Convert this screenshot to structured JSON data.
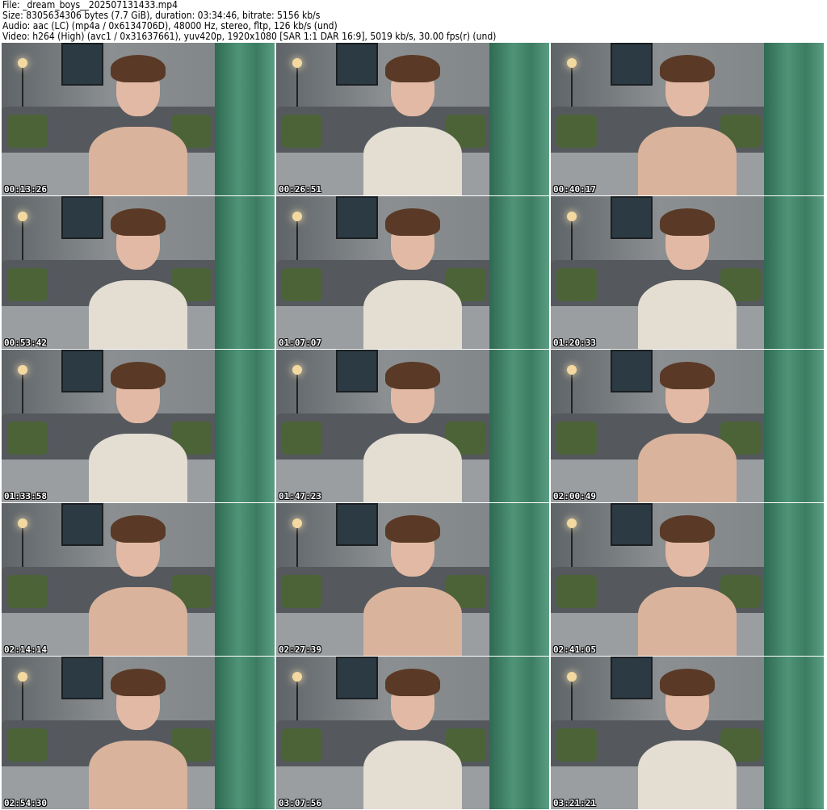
{
  "header": {
    "file": "File: _dream_boys__202507131433.mp4",
    "size": "Size: 8305634306 bytes (7.7 GiB), duration: 03:34:46, bitrate: 5156 kb/s",
    "audio": "Audio: aac (LC) (mp4a / 0x6134706D), 48000 Hz, stereo, fltp, 126 kb/s (und)",
    "video": "Video: h264 (High) (avc1 / 0x31637661), yuv420p, 1920x1080 [SAR 1:1 DAR 16:9], 5019 kb/s, 30.00 fps(r) (und)"
  },
  "thumbnails": [
    {
      "time": "00:13:26",
      "top": "#d9b39c"
    },
    {
      "time": "00:26:51",
      "top": "#e3ddd2"
    },
    {
      "time": "00:40:17",
      "top": "#d9b39c"
    },
    {
      "time": "00:53:42",
      "top": "#e3ddd2"
    },
    {
      "time": "01:07:07",
      "top": "#e3ddd2"
    },
    {
      "time": "01:20:33",
      "top": "#e3ddd2"
    },
    {
      "time": "01:33:58",
      "top": "#e3ddd2"
    },
    {
      "time": "01:47:23",
      "top": "#e3ddd2"
    },
    {
      "time": "02:00:49",
      "top": "#d9b39c"
    },
    {
      "time": "02:14:14",
      "top": "#d9b39c"
    },
    {
      "time": "02:27:39",
      "top": "#d9b39c"
    },
    {
      "time": "02:41:05",
      "top": "#d9b39c"
    },
    {
      "time": "02:54:30",
      "top": "#d9b39c"
    },
    {
      "time": "03:07:56",
      "top": "#e3ddd2"
    },
    {
      "time": "03:21:21",
      "top": "#e3ddd2"
    }
  ]
}
